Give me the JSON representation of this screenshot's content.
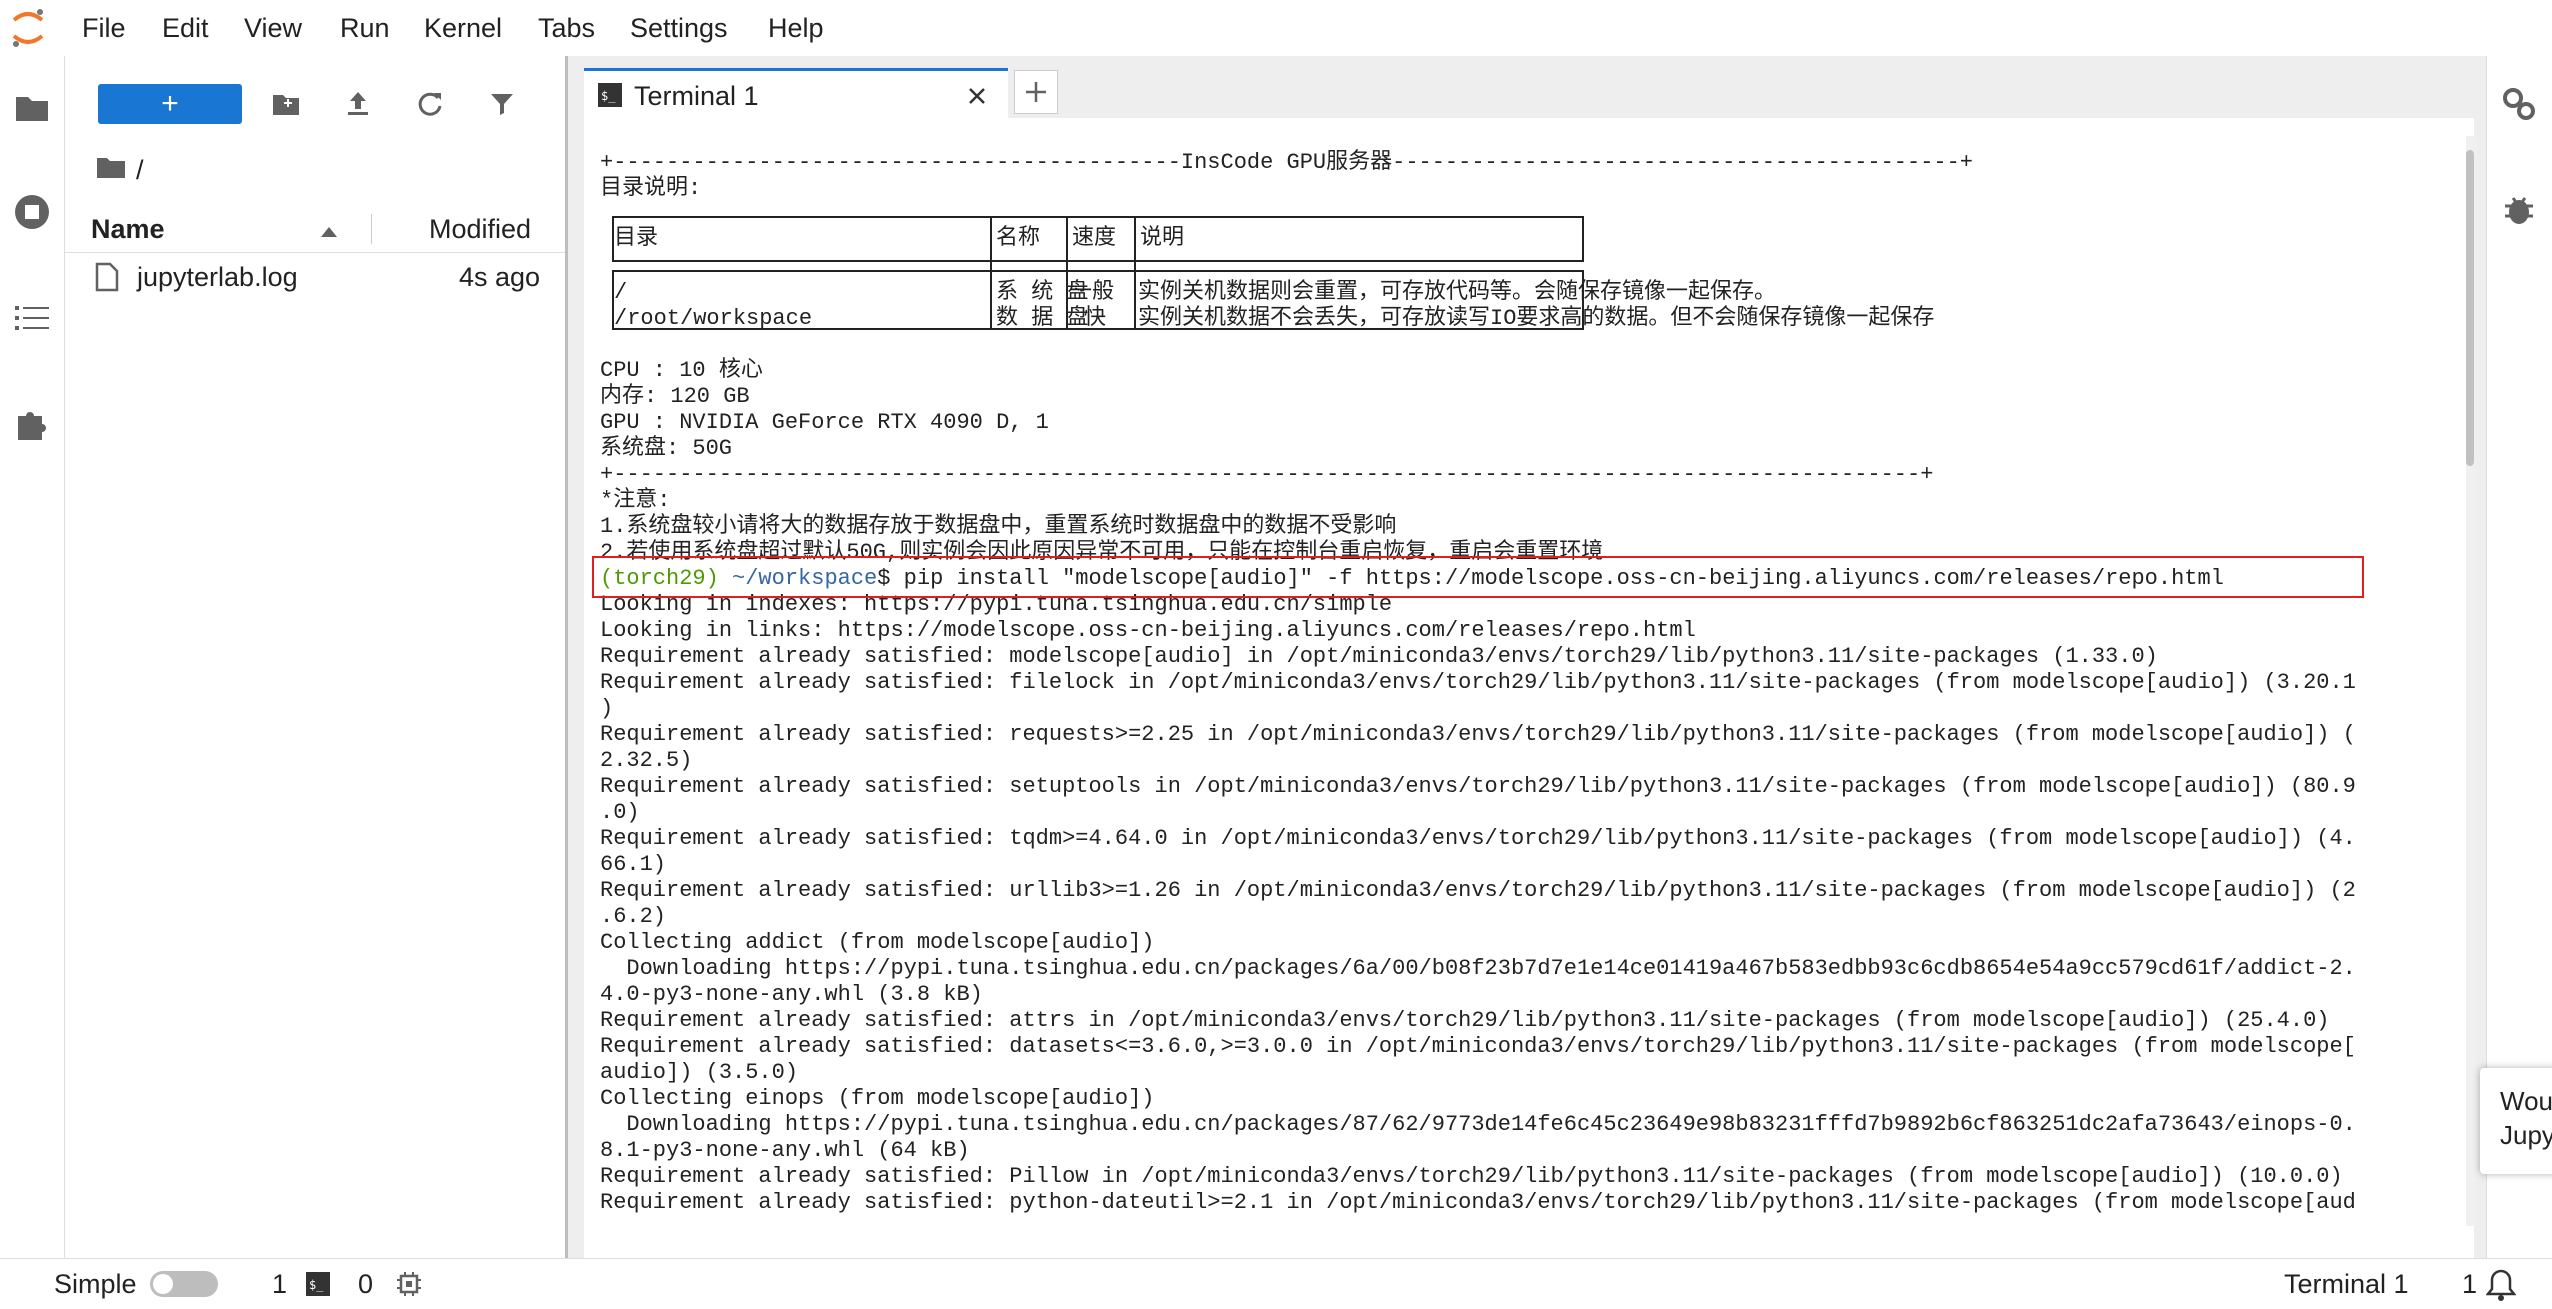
{
  "menu": {
    "items": [
      "File",
      "Edit",
      "View",
      "Run",
      "Kernel",
      "Tabs",
      "Settings",
      "Help"
    ]
  },
  "filebrowser": {
    "new_label": "+",
    "breadcrumb": "/",
    "col_name": "Name",
    "col_modified": "Modified",
    "files": [
      {
        "name": "jupyterlab.log",
        "modified": "4s ago"
      }
    ]
  },
  "tabs": [
    {
      "label": "Terminal 1"
    }
  ],
  "terminal": {
    "lines": [
      "+-------------------------------------------InsCode GPU服务器-------------------------------------------+",
      "目录说明:",
      "CPU : 10 核心",
      "内存: 120 GB",
      "GPU : NVIDIA GeForce RTX 4090 D, 1",
      "系统盘: 50G",
      "+---------------------------------------------------------------------------------------------------+",
      "*注意:",
      "1.系统盘较小请将大的数据存放于数据盘中，重置系统时数据盘中的数据不受影响",
      "2.若使用系统盘超过默认50G,则实例会因此原因异常不可用，只能在控制台重启恢复，重启会重置环境",
      "Looking in indexes: https://pypi.tuna.tsinghua.edu.cn/simple",
      "Looking in links: https://modelscope.oss-cn-beijing.aliyuncs.com/releases/repo.html",
      "Requirement already satisfied: modelscope[audio] in /opt/miniconda3/envs/torch29/lib/python3.11/site-packages (1.33.0)",
      "Requirement already satisfied: filelock in /opt/miniconda3/envs/torch29/lib/python3.11/site-packages (from modelscope[audio]) (3.20.1",
      ")",
      "Requirement already satisfied: requests>=2.25 in /opt/miniconda3/envs/torch29/lib/python3.11/site-packages (from modelscope[audio]) (",
      "2.32.5)",
      "Requirement already satisfied: setuptools in /opt/miniconda3/envs/torch29/lib/python3.11/site-packages (from modelscope[audio]) (80.9",
      ".0)",
      "Requirement already satisfied: tqdm>=4.64.0 in /opt/miniconda3/envs/torch29/lib/python3.11/site-packages (from modelscope[audio]) (4.",
      "66.1)",
      "Requirement already satisfied: urllib3>=1.26 in /opt/miniconda3/envs/torch29/lib/python3.11/site-packages (from modelscope[audio]) (2",
      ".6.2)",
      "Collecting addict (from modelscope[audio])",
      "  Downloading https://pypi.tuna.tsinghua.edu.cn/packages/6a/00/b08f23b7d7e1e14ce01419a467b583edbb93c6cdb8654e54a9cc579cd61f/addict-2.",
      "4.0-py3-none-any.whl (3.8 kB)",
      "Requirement already satisfied: attrs in /opt/miniconda3/envs/torch29/lib/python3.11/site-packages (from modelscope[audio]) (25.4.0)",
      "Requirement already satisfied: datasets<=3.6.0,>=3.0.0 in /opt/miniconda3/envs/torch29/lib/python3.11/site-packages (from modelscope[",
      "audio]) (3.5.0)",
      "Collecting einops (from modelscope[audio])",
      "  Downloading https://pypi.tuna.tsinghua.edu.cn/packages/87/62/9773de14fe6c45c23649e98b83231fffd7b9892b6cf863251dc2afa73643/einops-0.",
      "8.1-py3-none-any.whl (64 kB)",
      "Requirement already satisfied: Pillow in /opt/miniconda3/envs/torch29/lib/python3.11/site-packages (from modelscope[audio]) (10.0.0)",
      "Requirement already satisfied: python-dateutil>=2.1 in /opt/miniconda3/envs/torch29/lib/python3.11/site-packages (from modelscope[aud"
    ],
    "table": {
      "headers": [
        "目录",
        "名称",
        "速度",
        "说明"
      ],
      "row_paths": [
        "/",
        "/root/workspace"
      ],
      "row_names": [
        "系 统 盘",
        "数 据 盘"
      ],
      "row_speed": [
        "一般",
        "快"
      ],
      "row_desc": [
        "实例关机数据则会重置，可存放代码等。会随保存镜像一起保存。",
        "实例关机数据不会丢失，可存放读写IO要求高的数据。但不会随保存镜像一起保存"
      ]
    },
    "prompt_env": "(torch29)",
    "prompt_path": "~/workspace",
    "prompt_cmd": "$ pip install \"modelscope[audio]\" -f https://modelscope.oss-cn-beijing.aliyuncs.com/releases/repo.html"
  },
  "toast": {
    "line1": "Wou",
    "line2": "Jupy"
  },
  "statusbar": {
    "mode": "Simple",
    "kernels": "1",
    "terminals": "0",
    "active": "Terminal 1",
    "count": "1"
  },
  "colors": {
    "accent": "#1976d2",
    "prompt_env": "#4e9a06",
    "prompt_path": "#3465a4",
    "highlight": "#e02020"
  }
}
